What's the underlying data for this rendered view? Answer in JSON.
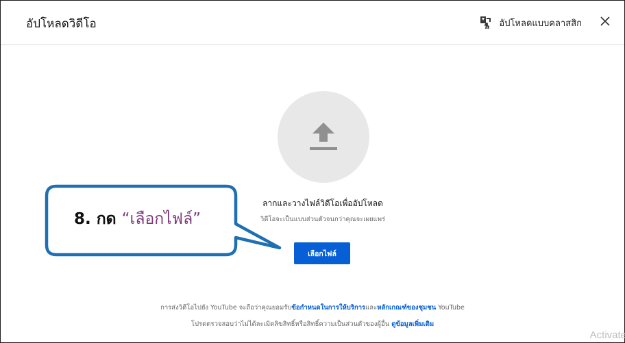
{
  "dialog": {
    "title": "อัปโหลดวิดีโอ",
    "classic_upload_label": "อัปโหลดแบบคลาสสิก",
    "close_icon": "close-icon",
    "classic_icon": "classic-upload-icon"
  },
  "upload": {
    "icon": "upload-arrow-icon",
    "drag_title": "ลากและวางไฟล์วิดีโอเพื่ออัปโหลด",
    "drag_subtitle": "วิดีโอจะเป็นแบบส่วนตัวจนกว่าคุณจะเผยแพร่",
    "select_button_label": "เลือกไฟล์"
  },
  "footer": {
    "line1_prefix": "การส่งวิดีโอไปยัง YouTube จะถือว่าคุณยอมรับ",
    "terms_link": "ข้อกำหนดในการให้บริการ",
    "line1_mid": "และ",
    "guidelines_link": "หลักเกณฑ์ของชุมชน",
    "line1_suffix": " YouTube",
    "line2_prefix": "โปรดตรวจสอบว่าไม่ได้ละเมิดลิขสิทธิ์หรือสิทธิ์ความเป็นส่วนตัวของผู้อื่น ",
    "learn_more_link": "ดูข้อมูลเพิ่มเติม"
  },
  "callout": {
    "step": "8. กด ",
    "highlight": "“เลือกไฟล์”",
    "border_color": "#1f6fb2",
    "highlight_color": "#7d3a7c"
  },
  "watermark": {
    "text": "Activate"
  },
  "colors": {
    "primary_button": "#065fd4",
    "link": "#065fd4"
  }
}
